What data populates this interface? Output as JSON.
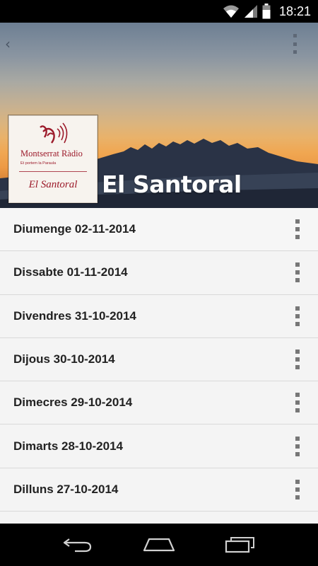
{
  "status_bar": {
    "time": "18:21",
    "icons": [
      "wifi-icon",
      "signal-icon",
      "battery-icon"
    ]
  },
  "header": {
    "back_icon": "chevron-left-icon",
    "overflow_icon": "more-vert-icon",
    "title": "El Santoral",
    "logo": {
      "station_name": "Montserrat Ràdio",
      "tagline": "Et portem la Paraula",
      "program": "El Santoral"
    }
  },
  "episodes": [
    {
      "label": "Diumenge 02-11-2014"
    },
    {
      "label": "Dissabte 01-11-2014"
    },
    {
      "label": "Divendres 31-10-2014"
    },
    {
      "label": "Dijous 30-10-2014"
    },
    {
      "label": "Dimecres 29-10-2014"
    },
    {
      "label": "Dimarts 28-10-2014"
    },
    {
      "label": "Dilluns 27-10-2014"
    }
  ],
  "nav_bar": {
    "icons": [
      "back-icon",
      "home-icon",
      "recents-icon"
    ]
  },
  "colors": {
    "brand": "#9c1a2a",
    "list_background": "#f4f4f4",
    "divider": "#d9d9d9"
  }
}
